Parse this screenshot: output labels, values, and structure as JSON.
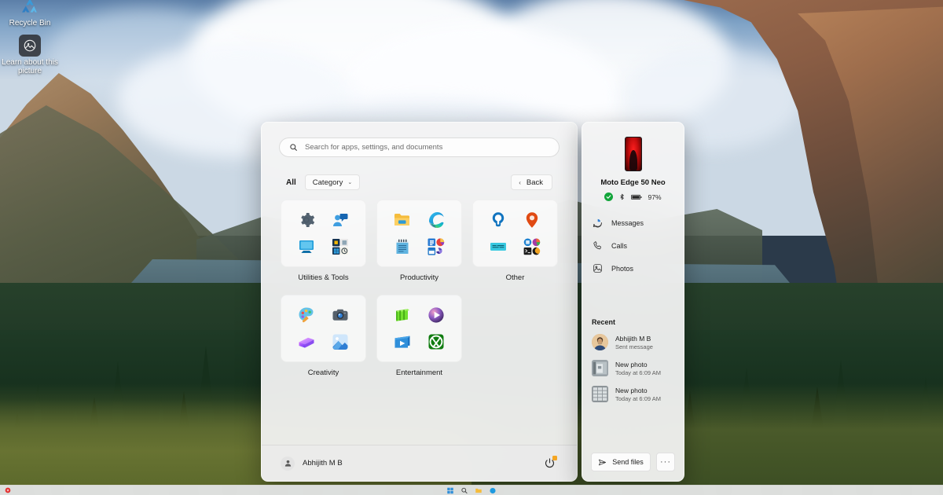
{
  "desktop": {
    "icons": [
      {
        "name": "Recycle Bin",
        "icon": "recycle-bin-icon"
      },
      {
        "name": "Learn about this picture",
        "icon": "picture-info-icon"
      }
    ]
  },
  "start_menu": {
    "search": {
      "placeholder": "Search for apps, settings, and documents",
      "value": "",
      "icon": "search-icon"
    },
    "controls": {
      "all_label": "All",
      "category_label": "Category",
      "category_chevron": "⌄",
      "back_label": "Back",
      "back_chevron": "‹"
    },
    "categories": [
      {
        "label": "Utilities & Tools",
        "icons": [
          "settings-gear-icon",
          "feedback-hub-icon",
          "remote-desktop-icon",
          "app-group-icon"
        ]
      },
      {
        "label": "Productivity",
        "icons": [
          "file-explorer-icon",
          "microsoft-edge-icon",
          "notepad-icon",
          "office-group-icon"
        ]
      },
      {
        "label": "Other",
        "icons": [
          "tips-lightbulb-icon",
          "maps-pin-icon",
          "terminal-icon",
          "misc-group-icon"
        ]
      },
      {
        "label": "Creativity",
        "icons": [
          "paint-palette-icon",
          "camera-icon",
          "clipchamp-icon",
          "photos-icon"
        ]
      },
      {
        "label": "Entertainment",
        "icons": [
          "movies-tv-icon",
          "media-player-icon",
          "video-editor-icon",
          "xbox-icon"
        ]
      }
    ],
    "footer": {
      "user_name": "Abhijith M B",
      "avatar_icon": "user-avatar-icon",
      "power_icon": "power-icon",
      "power_badge": "update-available-badge"
    }
  },
  "phone_panel": {
    "device": {
      "name": "Moto Edge 50 Neo",
      "thumbnail": "phone-wallpaper-thumbnail",
      "connected_icon": "connected-check-icon",
      "bluetooth_icon": "bluetooth-icon",
      "battery_icon": "battery-icon",
      "battery_level": "97%"
    },
    "nav": [
      {
        "label": "Messages",
        "icon": "messages-icon"
      },
      {
        "label": "Calls",
        "icon": "calls-phone-icon"
      },
      {
        "label": "Photos",
        "icon": "photos-gallery-icon"
      }
    ],
    "recent": {
      "title": "Recent",
      "items": [
        {
          "title": "Abhijith M B",
          "subtitle": "Sent message",
          "thumb": "contact-avatar"
        },
        {
          "title": "New photo",
          "subtitle": "Today at 6:09 AM",
          "thumb": "photo-thumbnail"
        },
        {
          "title": "New photo",
          "subtitle": "Today at 6:09 AM",
          "thumb": "photo-thumbnail"
        }
      ]
    },
    "footer": {
      "send_files_label": "Send files",
      "send_icon": "send-plane-icon",
      "more_label": "···"
    }
  },
  "taskbar": {
    "weather_label": "",
    "clock": ""
  },
  "colors": {
    "panel_bg": "#f3f3f3",
    "accent_blue": "#0078d4",
    "status_green": "#12a53a",
    "badge_amber": "#f5a623"
  }
}
